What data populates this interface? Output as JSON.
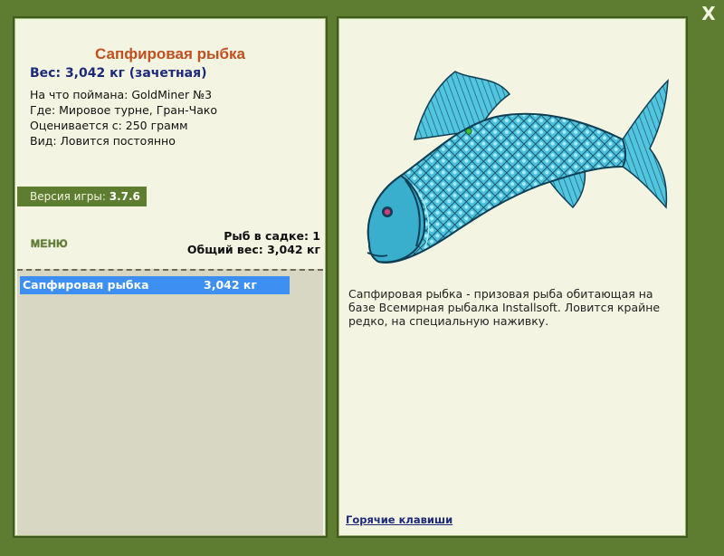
{
  "window": {
    "close_label": "X"
  },
  "fish": {
    "name": "Сапфировая рыбка",
    "weight_line": "Вес: 3,042 кг (зачетная)",
    "caught_on": "На что поймана: GoldMiner №3",
    "where": "Где: Мировое турне, Гран-Чако",
    "rated_from": "Оценивается с: 250 грамм",
    "kind": "Вид: Ловится постоянно",
    "description": "Сапфировая рыбка - призовая рыба обитающая на базе Всемирная рыбалка Installsoft. Ловится крайне редко, на специальную наживку."
  },
  "version": {
    "label": "Версия игры:",
    "value": "3.7.6"
  },
  "menu_label": "МЕНЮ",
  "cage": {
    "count_line": "Рыб в садке: 1",
    "total_weight_line": "Общий вес: 3,042 кг",
    "items": [
      {
        "name": "Сапфировая рыбка",
        "weight": "3,042 кг"
      }
    ]
  },
  "hotkeys_label": "Горячие клавиши",
  "colors": {
    "frame": "#5e7d31",
    "panel": "#f4f4e2",
    "title": "#c0501e",
    "accent_text": "#1d2a78",
    "selection": "#3d8ff2",
    "fish": "#3fb7d8"
  },
  "icons": {
    "close": "close-icon",
    "fish": "sapphire-fish-image"
  }
}
